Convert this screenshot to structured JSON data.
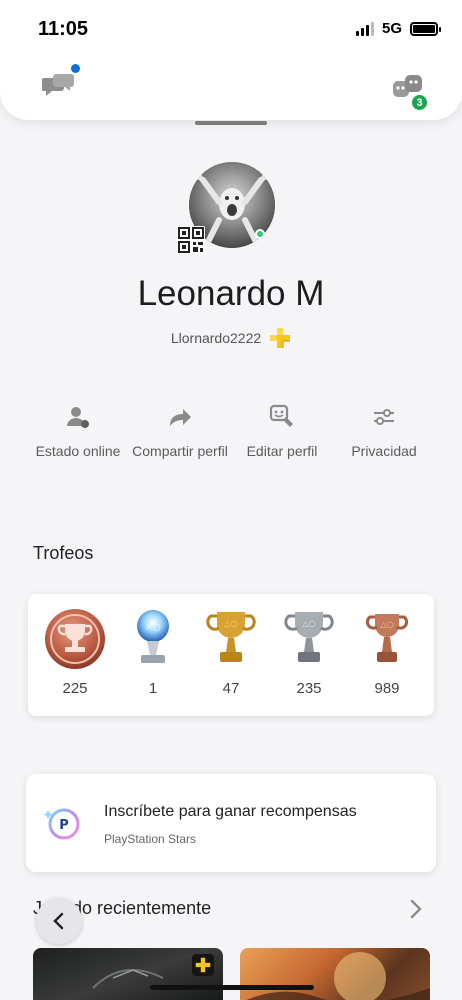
{
  "status_bar": {
    "time": "11:05",
    "network": "5G"
  },
  "header": {
    "friends_count": "3"
  },
  "profile": {
    "display_name": "Leonardo M",
    "username": "Llornardo2222"
  },
  "actions": [
    {
      "label": "Estado online",
      "icon": "person-status-icon"
    },
    {
      "label": "Compartir perfil",
      "icon": "share-arrow-icon"
    },
    {
      "label": "Editar perfil",
      "icon": "edit-profile-icon"
    },
    {
      "label": "Privacidad",
      "icon": "sliders-icon"
    }
  ],
  "trophies": {
    "title": "Trofeos",
    "items": [
      {
        "type": "level",
        "count": "225"
      },
      {
        "type": "platinum",
        "count": "1"
      },
      {
        "type": "gold",
        "count": "47"
      },
      {
        "type": "silver",
        "count": "235"
      },
      {
        "type": "bronze",
        "count": "989"
      }
    ]
  },
  "stars": {
    "title": "Inscríbete para ganar recompensas",
    "subtitle": "PlayStation Stars"
  },
  "recent": {
    "title": "Jugado recientemente"
  },
  "colors": {
    "online": "#2ecc71",
    "badge": "#1aa452",
    "notification": "#0b6fd6",
    "plus": "#f5c518"
  }
}
